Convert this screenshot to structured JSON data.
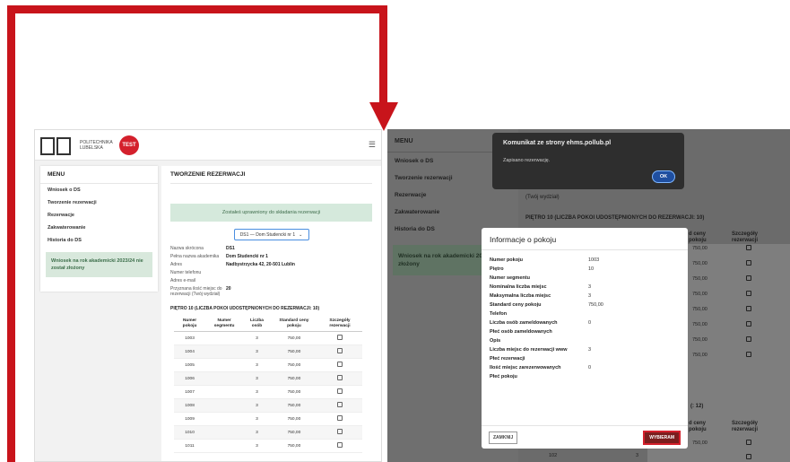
{
  "left": {
    "logo_text": "POLITECHNIKA LUBELSKA",
    "badge": "TEST",
    "menu": {
      "title": "MENU",
      "items": [
        {
          "label": "Wniosek o DS"
        },
        {
          "label": "Tworzenie rezerwacji"
        },
        {
          "label": "Rezerwacje"
        },
        {
          "label": "Zakwaterowanie"
        },
        {
          "label": "Historia do DS"
        }
      ],
      "notice": "Wniosek na rok akademicki 2023/24 nie został złożony"
    },
    "main": {
      "title": "TWORZENIE REZERWACJI",
      "success": "Zostałeś uprawniony do składania rezerwacji",
      "select_value": "DS1 — Dom Studencki nr 1",
      "info": [
        {
          "k": "Nazwa skrócona",
          "v": "DS1"
        },
        {
          "k": "Pełna nazwa akademika",
          "v": "Dom Studencki nr 1"
        },
        {
          "k": "Adres",
          "v": "Nadbystrzycka 42, 20-501 Lublin"
        },
        {
          "k": "Numer telefonu",
          "v": ""
        },
        {
          "k": "Adres e-mail",
          "v": ""
        },
        {
          "k": "Przyznana ilość miejsc do rezerwacji (Twój wydział)",
          "v": "20"
        }
      ],
      "floor_title": "PIĘTRO 10 (LICZBA POKOI UDOSTĘPNIONYCH DO REZERWACJI: 10)",
      "table_headers": [
        "Numer pokoju",
        "Numer segmentu",
        "Liczba osób",
        "Standard ceny pokoju",
        "Szczegóły rezerwacji"
      ],
      "rows": [
        {
          "room": "1003",
          "segment": "",
          "persons": "3",
          "price": "750,00"
        },
        {
          "room": "1004",
          "segment": "",
          "persons": "3",
          "price": "750,00"
        },
        {
          "room": "1005",
          "segment": "",
          "persons": "3",
          "price": "750,00"
        },
        {
          "room": "1006",
          "segment": "",
          "persons": "3",
          "price": "750,00"
        },
        {
          "room": "1007",
          "segment": "",
          "persons": "3",
          "price": "750,00"
        },
        {
          "room": "1008",
          "segment": "",
          "persons": "3",
          "price": "750,00"
        },
        {
          "room": "1009",
          "segment": "",
          "persons": "3",
          "price": "750,00"
        },
        {
          "room": "1010",
          "segment": "",
          "persons": "3",
          "price": "750,00"
        },
        {
          "room": "1011",
          "segment": "",
          "persons": "3",
          "price": "750,00"
        }
      ]
    }
  },
  "right": {
    "menu": {
      "title": "MENU",
      "items": [
        {
          "label": "Wniosek o DS"
        },
        {
          "label": "Tworzenie rezerwacji"
        },
        {
          "label": "Rezerwacje"
        },
        {
          "label": "Zakwaterowanie"
        },
        {
          "label": "Historia do DS"
        }
      ],
      "notice": "Wniosek na rok akademicki 202... został złożony"
    },
    "bg_text_faculty": "(Twój wydział)",
    "bg_floor_title": "PIĘTRO 10 (LICZBA POKOI UDOSTĘPNIONYCH DO REZERWACJI: 10)",
    "bg_header_price": "d ceny pokoju",
    "bg_header_details": "Szczegóły rezerwacji",
    "bg_prices": [
      "750,00",
      "750,00",
      "750,00",
      "750,00",
      "750,00",
      "750,00",
      "750,00",
      "750,00"
    ],
    "bg_floor2_suffix": "(: 12)",
    "bg_price2": "750,00",
    "bg_room2": "102",
    "bg_persons2": "3",
    "alert": {
      "title": "Komunikat ze strony ehms.pollub.pl",
      "message": "Zapisano rezerwację.",
      "ok": "OK"
    },
    "modal": {
      "title": "Informacje o pokoju",
      "fields": [
        {
          "k": "Numer pokoju",
          "v": "1003"
        },
        {
          "k": "Piętro",
          "v": "10"
        },
        {
          "k": "Numer segmentu",
          "v": ""
        },
        {
          "k": "Nominalna liczba miejsc",
          "v": "3"
        },
        {
          "k": "Maksymalna liczba miejsc",
          "v": "3"
        },
        {
          "k": "Standard ceny pokoju",
          "v": "750,00"
        },
        {
          "k": "Telefon",
          "v": ""
        },
        {
          "k": "Liczba osób zameldowanych",
          "v": "0"
        },
        {
          "k": "Płeć osób zameldowanych",
          "v": ""
        },
        {
          "k": "Opis",
          "v": ""
        },
        {
          "k": "Liczba miejsc do rezerwacji www",
          "v": "3"
        },
        {
          "k": "Płeć rezerwacji",
          "v": ""
        },
        {
          "k": "Ilość miejsc zarezerwowanych",
          "v": "0"
        },
        {
          "k": "Płeć pokoju",
          "v": ""
        }
      ],
      "close_label": "ZAMKNIJ",
      "select_label": "WYBIERAM"
    }
  },
  "colors": {
    "arrow": "#c8141b",
    "success_bg": "#d5e9dc",
    "badge": "#d4202c",
    "alert_bg": "#2e2e2e"
  }
}
